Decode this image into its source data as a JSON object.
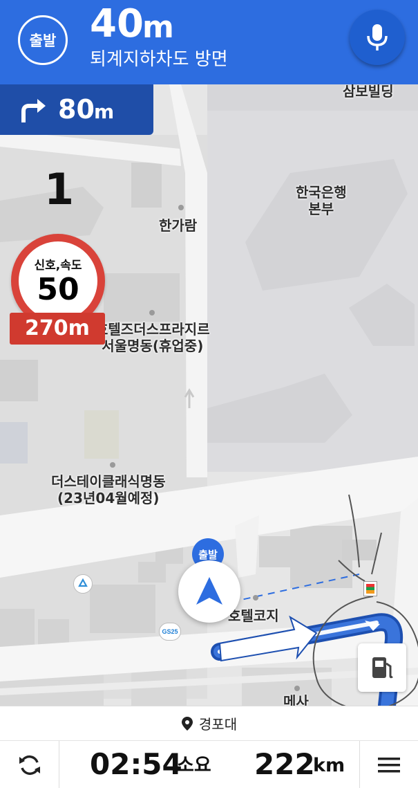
{
  "guidance": {
    "departure_badge": "출발",
    "distance_value": "40",
    "distance_unit": "m",
    "direction": "퇴계지하차도 방면",
    "next_turn_value": "80",
    "next_turn_unit": "m",
    "lane_number": "1"
  },
  "speed_camera": {
    "type": "신호,속도",
    "limit": "50",
    "distance": "270m"
  },
  "map_labels": {
    "samboh_building": "삼보빌딩",
    "hangaram": "한가람",
    "bank_of_korea_1": "한국은행",
    "bank_of_korea_2": "본부",
    "hotel_prestige_1": "호텔즈더스프라지르",
    "hotel_prestige_2": "서울명동(휴업중)",
    "the_stay_1": "더스테이클래식명동",
    "the_stay_2": "(23년04월예정)",
    "hotel_cozy": "호텔코지",
    "mesa": "메사",
    "gs25": "GS25",
    "start_marker": "출발"
  },
  "destination": {
    "name": "경포대"
  },
  "trip": {
    "time": "02:54",
    "time_suffix": "소요",
    "distance_value": "222",
    "distance_unit": "km"
  },
  "icons": {
    "mic": "microphone-icon",
    "turn": "turn-right-arrow-icon",
    "location": "location-pin-icon",
    "reroute": "refresh-icon",
    "menu": "hamburger-menu-icon",
    "gas": "gas-station-icon",
    "recycle": "recycle-icon",
    "convenience": "convenience-store-icon"
  },
  "colors": {
    "guidance_blue": "#2d6de0",
    "next_turn_blue": "#1f4ea8",
    "route_blue": "#3a74db",
    "speed_red": "#d9433a"
  }
}
